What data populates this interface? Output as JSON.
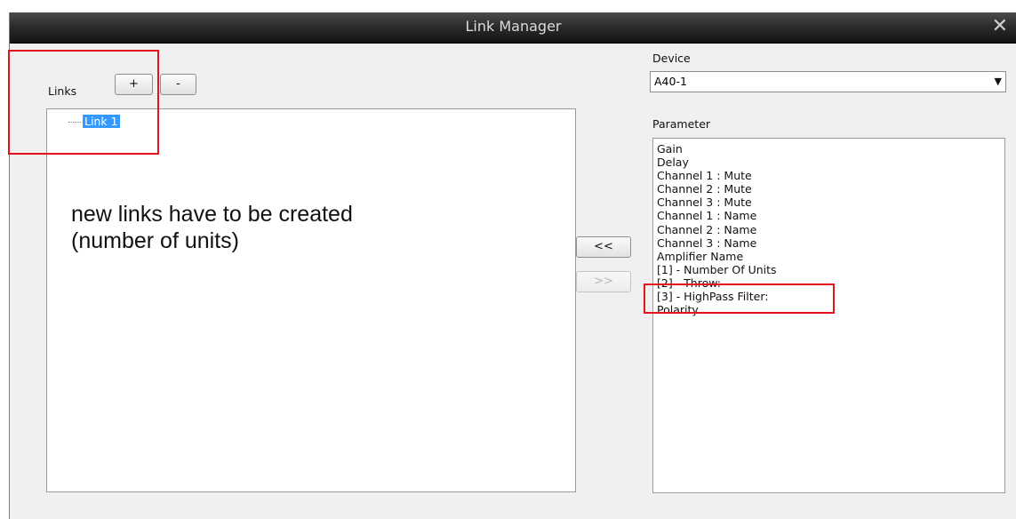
{
  "window": {
    "title": "Link Manager",
    "close_glyph": "✕"
  },
  "links": {
    "label": "Links",
    "add_label": "+",
    "remove_label": "-",
    "items": [
      "Link 1"
    ]
  },
  "annotation": {
    "line1": "new links have to be created",
    "line2": "(number of units)"
  },
  "transfer": {
    "add_label": "<<",
    "remove_label": ">>"
  },
  "device": {
    "label": "Device",
    "selected": "A40-1"
  },
  "parameter": {
    "label": "Parameter",
    "items": [
      "Gain",
      "Delay",
      "Channel 1 : Mute",
      "Channel 2 : Mute",
      "Channel 3 : Mute",
      "Channel 1 : Name",
      "Channel 2 : Name",
      "Channel 3 : Name",
      "Amplifier Name",
      "[1] - Number Of Units",
      "[2] - Throw:",
      "[3] - HighPass Filter:",
      "Polarity"
    ]
  },
  "colors": {
    "highlight_box": "#e0141a",
    "selection": "#3399ff",
    "titlebar": "#2c2c2c"
  }
}
